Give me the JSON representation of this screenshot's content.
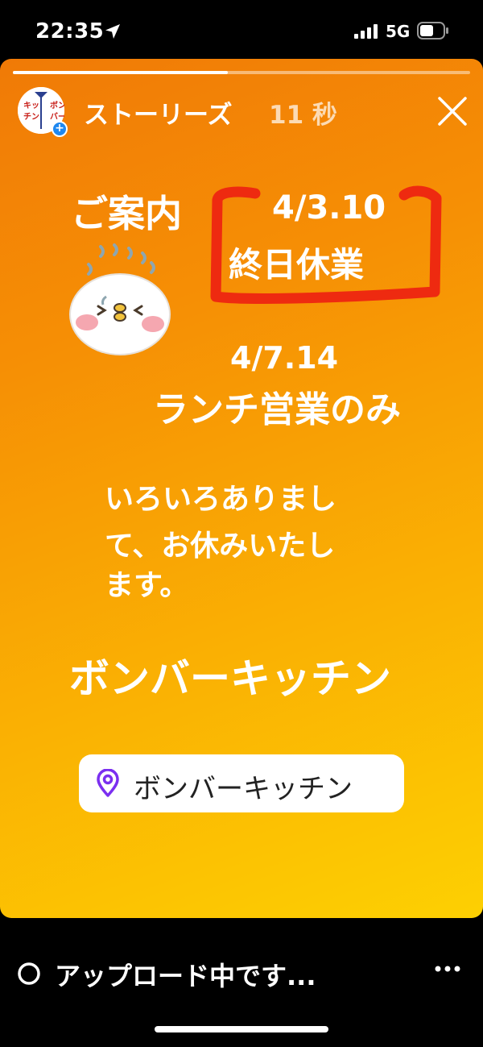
{
  "status_bar": {
    "time": "22:35",
    "network": "5G",
    "icons": [
      "location-arrow-icon",
      "signal-bars-icon",
      "battery-icon"
    ]
  },
  "story": {
    "progress": 0.47,
    "account": {
      "name": "ストーリーズ",
      "time_ago": "11 秒",
      "avatar_text": [
        "ボン",
        "バー",
        "キッ",
        "チン"
      ]
    },
    "heading": "ご案内",
    "closed": {
      "dates": "4/3.10",
      "label": "終日休業"
    },
    "lunch": {
      "dates": "4/7.14",
      "label": "ランチ営業のみ"
    },
    "message_lines": [
      "いろいろありまし",
      "て、お休みいたし",
      "ます。"
    ],
    "shop_name": "ボンバーキッチン",
    "location_sticker": {
      "label": "ボンバーキッチン",
      "icon": "location-pin-icon"
    },
    "colors": {
      "gradient_start": "#f07a06",
      "gradient_end": "#fdd002",
      "highlight_red": "#ee2a10",
      "pin_purple": "#7b2ff0"
    }
  },
  "bottom_bar": {
    "upload_status": "アップロード中です...",
    "more_icon": "more-horizontal-icon"
  }
}
